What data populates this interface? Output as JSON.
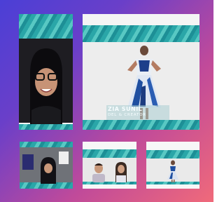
{
  "main_video": {
    "caption_name": "ZIA SUNIL",
    "caption_role": "DEL & CREATOR"
  },
  "colors": {
    "gradient_top": "#4b3fd6",
    "gradient_bottom": "#f06a7a",
    "ocean": "#2aa6a8"
  },
  "tiles": [
    {
      "name": "participant-tile-1",
      "content": "person with headscarf and glasses"
    },
    {
      "name": "participant-tile-main",
      "content": "model in blue and white dress"
    },
    {
      "name": "participant-tile-2",
      "content": "person with headscarf"
    },
    {
      "name": "participant-tile-3",
      "content": "two persons"
    },
    {
      "name": "participant-tile-4",
      "content": "person in dress"
    }
  ]
}
